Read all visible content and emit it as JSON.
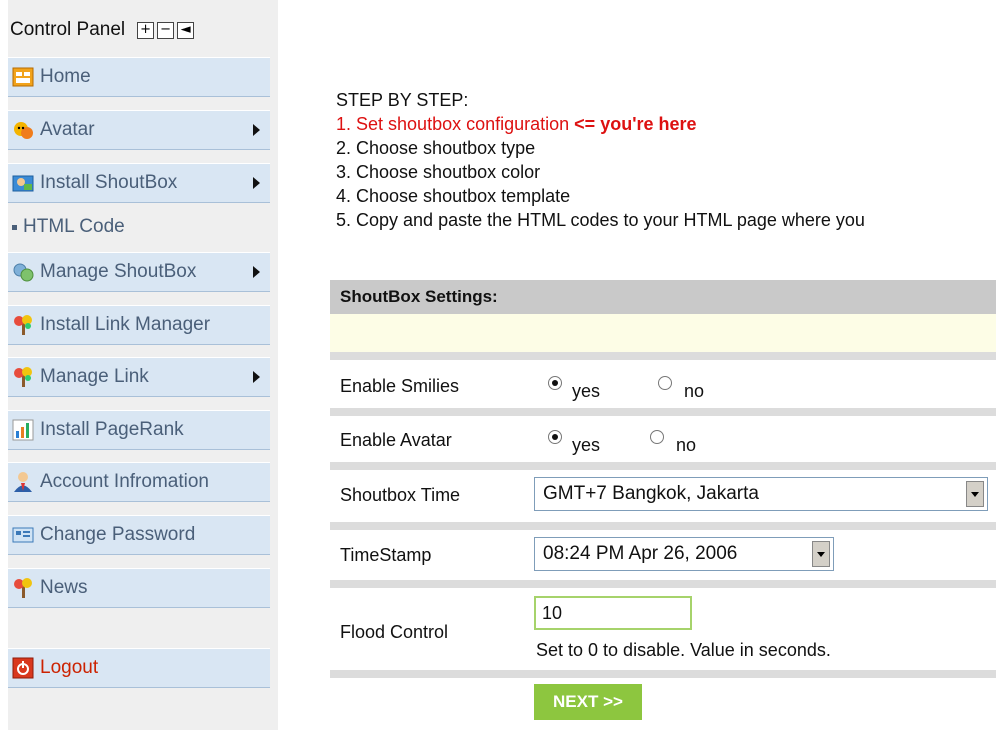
{
  "sidebar": {
    "title": "Control Panel",
    "controls": [
      "+",
      "−",
      "◄"
    ],
    "items": [
      {
        "label": "Home",
        "icon": "home-icon"
      },
      {
        "label": "Avatar",
        "icon": "avatar-icon"
      },
      {
        "label": "Install ShoutBox",
        "icon": "install-shoutbox-icon"
      },
      {
        "label": "Manage ShoutBox",
        "icon": "manage-shoutbox-icon"
      },
      {
        "label": "Install Link Manager",
        "icon": "link-manager-icon"
      },
      {
        "label": "Manage Link",
        "icon": "manage-link-icon"
      },
      {
        "label": "Install PageRank",
        "icon": "pagerank-icon"
      },
      {
        "label": "Account Infromation",
        "icon": "account-icon"
      },
      {
        "label": "Change Password",
        "icon": "password-icon"
      },
      {
        "label": "News",
        "icon": "news-icon"
      },
      {
        "label": "Logout",
        "icon": "logout-icon"
      }
    ],
    "sub_item": "HTML Code"
  },
  "steps": {
    "heading": "STEP BY STEP:",
    "step1": "1. Set shoutbox configuration ",
    "step1_marker": "<= you're here",
    "step2": "2. Choose shoutbox type",
    "step3": "3. Choose shoutbox color",
    "step4": "4. Choose shoutbox template",
    "step5": "5. Copy and paste the HTML codes to your HTML page where you"
  },
  "settings": {
    "title": "ShoutBox Settings:",
    "smilies": {
      "label": "Enable Smilies",
      "yes": "yes",
      "no": "no",
      "selected": "yes"
    },
    "avatar": {
      "label": "Enable Avatar",
      "yes": "yes",
      "no": "no",
      "selected": "yes"
    },
    "time": {
      "label": "Shoutbox Time",
      "value": "GMT+7 Bangkok, Jakarta"
    },
    "timestamp": {
      "label": "TimeStamp",
      "value": "08:24 PM Apr 26, 2006"
    },
    "flood": {
      "label": "Flood Control",
      "value": "10",
      "hint": "Set to 0 to disable. Value in seconds."
    },
    "next_label": "NEXT >>"
  },
  "colors": {
    "nav_bg": "#d9e6f3",
    "nav_text": "#4a5f79",
    "highlight": "#dd1111",
    "next_btn": "#8dc63f"
  }
}
